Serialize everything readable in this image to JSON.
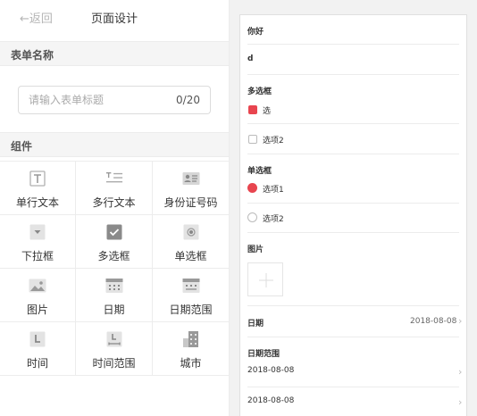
{
  "header": {
    "back_label": "←返回",
    "title": "页面设计"
  },
  "form_name_section": {
    "title": "表单名称",
    "input_placeholder": "请输入表单标题",
    "input_value": "",
    "counter": "0/20"
  },
  "components_section": {
    "title": "组件",
    "items": [
      {
        "label": "单行文本",
        "icon": "single-line-text-icon"
      },
      {
        "label": "多行文本",
        "icon": "multi-line-text-icon"
      },
      {
        "label": "身份证号码",
        "icon": "id-card-icon"
      },
      {
        "label": "下拉框",
        "icon": "dropdown-icon"
      },
      {
        "label": "多选框",
        "icon": "checkbox-icon"
      },
      {
        "label": "单选框",
        "icon": "radio-icon"
      },
      {
        "label": "图片",
        "icon": "image-icon"
      },
      {
        "label": "日期",
        "icon": "calendar-icon"
      },
      {
        "label": "日期范围",
        "icon": "date-range-icon"
      },
      {
        "label": "时间",
        "icon": "time-icon"
      },
      {
        "label": "时间范围",
        "icon": "time-range-icon"
      },
      {
        "label": "城市",
        "icon": "city-icon"
      }
    ]
  },
  "preview": {
    "greeting": "你好",
    "text_value": "d",
    "checkbox_title": "多选框",
    "checkbox_options": [
      {
        "label": "选",
        "checked": true
      },
      {
        "label": "选项2",
        "checked": false
      }
    ],
    "radio_title": "单选框",
    "radio_options": [
      {
        "label": "选项1",
        "checked": true
      },
      {
        "label": "选项2",
        "checked": false
      }
    ],
    "image_title": "图片",
    "date_title": "日期",
    "date_value": "2018-08-08",
    "date_range_title": "日期范围",
    "date_range_start": "2018-08-08",
    "date_range_end": "2018-08-08"
  },
  "colors": {
    "accent": "#e8454f",
    "section_bg": "#f5f5f5",
    "icon_gray": "#b0b0b0"
  }
}
